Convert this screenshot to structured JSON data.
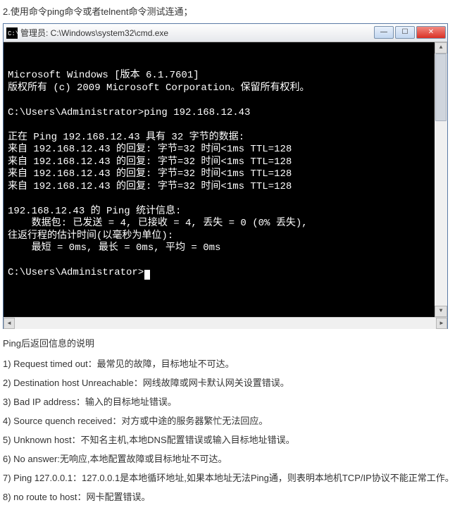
{
  "instruction": "2.使用命令ping命令或者telnent命令测试连通；",
  "window": {
    "icon_label": "cmd-icon",
    "title": "管理员: C:\\Windows\\system32\\cmd.exe",
    "btn_min_glyph": "—",
    "btn_max_glyph": "☐",
    "btn_close_glyph": "✕"
  },
  "terminal_lines": [
    "Microsoft Windows [版本 6.1.7601]",
    "版权所有 (c) 2009 Microsoft Corporation。保留所有权利。",
    "",
    "C:\\Users\\Administrator>ping 192.168.12.43",
    "",
    "正在 Ping 192.168.12.43 具有 32 字节的数据:",
    "来自 192.168.12.43 的回复: 字节=32 时间<1ms TTL=128",
    "来自 192.168.12.43 的回复: 字节=32 时间<1ms TTL=128",
    "来自 192.168.12.43 的回复: 字节=32 时间<1ms TTL=128",
    "来自 192.168.12.43 的回复: 字节=32 时间<1ms TTL=128",
    "",
    "192.168.12.43 的 Ping 统计信息:",
    "    数据包: 已发送 = 4, 已接收 = 4, 丢失 = 0 (0% 丢失),",
    "往返行程的估计时间(以毫秒为单位):",
    "    最短 = 0ms, 最长 = 0ms, 平均 = 0ms",
    "",
    "C:\\Users\\Administrator>_"
  ],
  "notes": {
    "title": "Ping后返回信息的说明",
    "items": [
      "1) Request timed out：最常见的故障，目标地址不可达。",
      "2) Destination host Unreachable：网线故障或网卡默认网关设置错误。",
      "3) Bad IP address：输入的目标地址错误。",
      "4) Source quench received：对方或中途的服务器繁忙无法回应。",
      "5) Unknown host：不知名主机,本地DNS配置错误或输入目标地址错误。",
      "6) No answer:无响应,本地配置故障或目标地址不可达。",
      "7) Ping 127.0.0.1：127.0.0.1是本地循环地址,如果本地址无法Ping通，则表明本地机TCP/IP协议不能正常工作。",
      "8) no route to host：网卡配置错误。"
    ]
  }
}
